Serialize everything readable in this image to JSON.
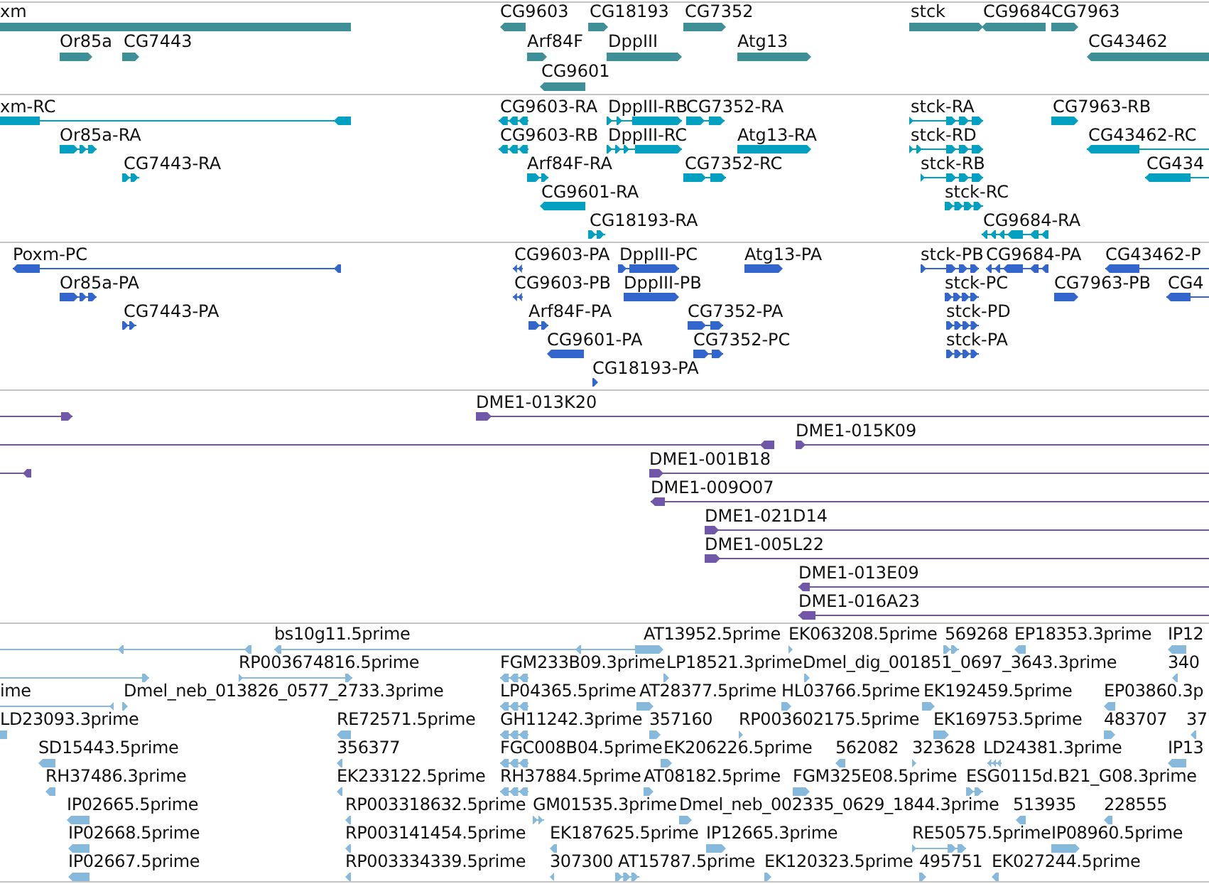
{
  "tracks": [
    {
      "color": "#3f8f96",
      "features": [
        {
          "label": "xm",
          "reverse": true
        },
        {
          "label": "CG9603",
          "reverse": true
        },
        {
          "label": "CG18193",
          "reverse": false
        },
        {
          "label": "CG7352",
          "reverse": false
        },
        {
          "label": "stck",
          "reverse": false
        },
        {
          "label": "CG9684",
          "reverse": true
        },
        {
          "label": "CG7963",
          "reverse": false
        },
        {
          "label": "Or85a",
          "reverse": false
        },
        {
          "label": "CG7443",
          "reverse": false
        },
        {
          "label": "Arf84F",
          "reverse": false
        },
        {
          "label": "DppIII",
          "reverse": false
        },
        {
          "label": "Atg13",
          "reverse": false
        },
        {
          "label": "CG43462",
          "reverse": true
        },
        {
          "label": "CG9601",
          "reverse": true
        }
      ]
    },
    {
      "color": "#00a0c0",
      "features": [
        {
          "label": "xm-RC",
          "reverse": true
        },
        {
          "label": "CG9603-RA",
          "reverse": true
        },
        {
          "label": "DppIII-RB",
          "reverse": false
        },
        {
          "label": "CG7352-RA",
          "reverse": false
        },
        {
          "label": "stck-RA",
          "reverse": false
        },
        {
          "label": "CG7963-RB",
          "reverse": false
        },
        {
          "label": "Or85a-RA",
          "reverse": false
        },
        {
          "label": "CG9603-RB",
          "reverse": true
        },
        {
          "label": "DppIII-RC",
          "reverse": false
        },
        {
          "label": "Atg13-RA",
          "reverse": false
        },
        {
          "label": "stck-RD",
          "reverse": false
        },
        {
          "label": "CG43462-RC",
          "reverse": true
        },
        {
          "label": "CG7443-RA",
          "reverse": false
        },
        {
          "label": "Arf84F-RA",
          "reverse": false
        },
        {
          "label": "CG7352-RC",
          "reverse": false
        },
        {
          "label": "stck-RB",
          "reverse": false
        },
        {
          "label": "CG434",
          "reverse": true
        },
        {
          "label": "CG9601-RA",
          "reverse": true
        },
        {
          "label": "stck-RC",
          "reverse": false
        },
        {
          "label": "CG18193-RA",
          "reverse": false
        },
        {
          "label": "CG9684-RA",
          "reverse": true
        }
      ]
    },
    {
      "color": "#3366cc",
      "features": [
        {
          "label": "Poxm-PC",
          "reverse": true
        },
        {
          "label": "CG9603-PA",
          "reverse": true
        },
        {
          "label": "DppIII-PC",
          "reverse": false
        },
        {
          "label": "Atg13-PA",
          "reverse": false
        },
        {
          "label": "stck-PB",
          "reverse": false
        },
        {
          "label": "CG9684-PA",
          "reverse": true
        },
        {
          "label": "CG43462-P",
          "reverse": true
        },
        {
          "label": "Or85a-PA",
          "reverse": false
        },
        {
          "label": "CG9603-PB",
          "reverse": true
        },
        {
          "label": "DppIII-PB",
          "reverse": false
        },
        {
          "label": "stck-PC",
          "reverse": false
        },
        {
          "label": "CG7963-PB",
          "reverse": false
        },
        {
          "label": "CG4",
          "reverse": true
        },
        {
          "label": "CG7443-PA",
          "reverse": false
        },
        {
          "label": "Arf84F-PA",
          "reverse": false
        },
        {
          "label": "CG7352-PA",
          "reverse": false
        },
        {
          "label": "stck-PD",
          "reverse": false
        },
        {
          "label": "CG9601-PA",
          "reverse": true
        },
        {
          "label": "CG7352-PC",
          "reverse": false
        },
        {
          "label": "stck-PA",
          "reverse": false
        },
        {
          "label": "CG18193-PA",
          "reverse": false
        }
      ]
    },
    {
      "color": "#7057a8",
      "features": [
        {
          "reverse": false
        },
        {
          "label": "DME1-013K20",
          "reverse": false
        },
        {
          "reverse": true
        },
        {
          "label": "DME1-015K09",
          "reverse": false
        },
        {
          "reverse": true
        },
        {
          "label": "DME1-001B18",
          "reverse": false
        },
        {
          "label": "DME1-009O07",
          "reverse": true
        },
        {
          "label": "DME1-021D14",
          "reverse": false
        },
        {
          "label": "DME1-005L22",
          "reverse": false
        },
        {
          "label": "DME1-013E09",
          "reverse": true
        },
        {
          "label": "DME1-016A23",
          "reverse": true
        }
      ]
    },
    {
      "color": "#86b9dc",
      "features": [
        {
          "reverse": true
        },
        {
          "label": "bs10g11.5prime",
          "reverse": true
        },
        {
          "label": "AT13952.5prime",
          "reverse": false
        },
        {
          "label": "EK063208.5prime",
          "reverse": false
        },
        {
          "label": "569268",
          "reverse": false
        },
        {
          "label": "EP18353.3prime",
          "reverse": true
        },
        {
          "label": "IP12",
          "reverse": true
        },
        {
          "reverse": false
        },
        {
          "label": "RP003674816.5prime",
          "reverse": false
        },
        {
          "label": "FGM233B09.3prime",
          "reverse": true
        },
        {
          "label": "LP18521.3prime",
          "reverse": false
        },
        {
          "label": "Dmel_dig_001851_0697_3643.3prime",
          "reverse": false
        },
        {
          "label": "340",
          "reverse": true
        },
        {
          "label": "ime",
          "reverse": true
        },
        {
          "label": "Dmel_neb_013826_0577_2733.3prime",
          "reverse": false
        },
        {
          "label": "LP04365.5prime",
          "reverse": true
        },
        {
          "label": "AT28377.5prime",
          "reverse": false
        },
        {
          "label": "HL03766.5prime",
          "reverse": false
        },
        {
          "label": "EK192459.5prime",
          "reverse": false
        },
        {
          "label": "EP03860.3p",
          "reverse": true
        },
        {
          "label": "LD23093.3prime",
          "reverse": true
        },
        {
          "label": "RE72571.5prime",
          "reverse": true
        },
        {
          "label": "GH11242.3prime",
          "reverse": true
        },
        {
          "label": "357160",
          "reverse": false
        },
        {
          "label": "RP003602175.5prime",
          "reverse": false
        },
        {
          "label": "EK169753.5prime",
          "reverse": false
        },
        {
          "label": "483707",
          "reverse": false
        },
        {
          "label": "37",
          "reverse": true
        },
        {
          "label": "SD15443.5prime",
          "reverse": true
        },
        {
          "label": "356377",
          "reverse": true
        },
        {
          "label": "FGC008B04.5prime",
          "reverse": true
        },
        {
          "label": "EK206226.5prime",
          "reverse": false
        },
        {
          "label": "562082",
          "reverse": true
        },
        {
          "label": "323628",
          "reverse": false
        },
        {
          "label": "LD24381.3prime",
          "reverse": true
        },
        {
          "label": "IP13",
          "reverse": true
        },
        {
          "label": "RH37486.3prime",
          "reverse": true
        },
        {
          "label": "EK233122.5prime",
          "reverse": true
        },
        {
          "label": "RH37884.5prime",
          "reverse": true
        },
        {
          "label": "AT08182.5prime",
          "reverse": false
        },
        {
          "label": "FGM325E08.5prime",
          "reverse": false
        },
        {
          "label": "ESG0115d.B21_G08.3prime",
          "reverse": false
        },
        {
          "label": "IP02665.5prime",
          "reverse": true
        },
        {
          "label": "RP003318632.5prime",
          "reverse": true
        },
        {
          "label": "GM01535.3prime",
          "reverse": false
        },
        {
          "label": "Dmel_neb_002335_0629_1844.3prime",
          "reverse": false
        },
        {
          "label": "513935",
          "reverse": true
        },
        {
          "label": "228555",
          "reverse": true
        },
        {
          "label": "IP02668.5prime",
          "reverse": true
        },
        {
          "label": "RP003141454.5prime",
          "reverse": true
        },
        {
          "label": "EK187625.5prime",
          "reverse": true
        },
        {
          "label": "IP12665.3prime",
          "reverse": false
        },
        {
          "label": "RE50575.5prime",
          "reverse": false
        },
        {
          "label": "IP08960.5prime",
          "reverse": false
        },
        {
          "label": "IP02667.5prime",
          "reverse": true
        },
        {
          "label": "RP003334339.5prime",
          "reverse": true
        },
        {
          "label": "307300",
          "reverse": true
        },
        {
          "label": "AT15787.5prime",
          "reverse": false
        },
        {
          "label": "EK120323.5prime",
          "reverse": false
        },
        {
          "label": "495751",
          "reverse": false
        },
        {
          "label": "EK027244.5prime",
          "reverse": true
        }
      ]
    }
  ]
}
